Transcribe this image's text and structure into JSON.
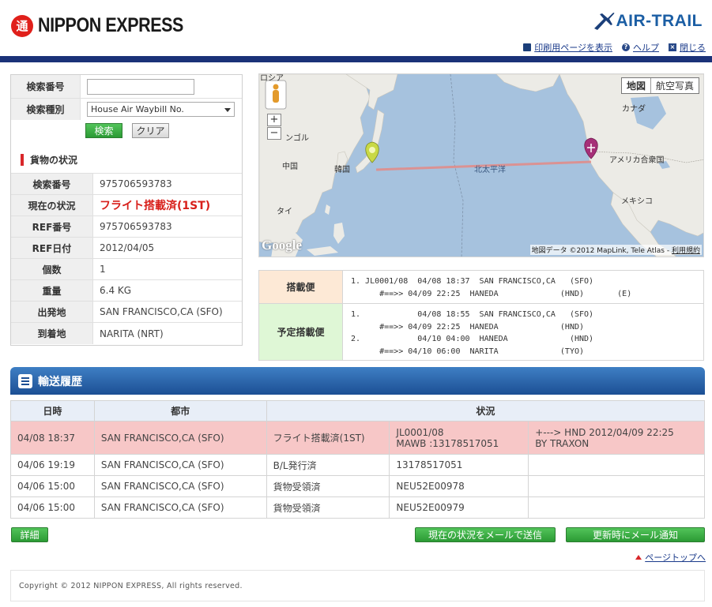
{
  "header": {
    "brand_left": "NIPPON EXPRESS",
    "brand_left_mark": "通",
    "brand_right": "AIR-TRAIL",
    "links": {
      "print": "印刷用ページを表示",
      "help": "ヘルプ",
      "close": "閉じる"
    }
  },
  "search": {
    "number_label": "検索番号",
    "number_value": "",
    "type_label": "検索種別",
    "type_selected": "House Air Waybill No.",
    "search_button": "検索",
    "clear_button": "クリア"
  },
  "status": {
    "title": "貨物の状況",
    "rows": [
      {
        "label": "検索番号",
        "value": "975706593783"
      },
      {
        "label": "現在の状況",
        "value": "フライト搭載済(1ST)"
      },
      {
        "label": "REF番号",
        "value": "975706593783"
      },
      {
        "label": "REF日付",
        "value": "2012/04/05"
      },
      {
        "label": "個数",
        "value": "1"
      },
      {
        "label": "重量",
        "value": "6.4 KG"
      },
      {
        "label": "出発地",
        "value": "SAN FRANCISCO,CA (SFO)"
      },
      {
        "label": "到着地",
        "value": "NARITA (NRT)"
      }
    ]
  },
  "map": {
    "toggle_map": "地図",
    "toggle_aerial": "航空写真",
    "zoom_in": "+",
    "zoom_out": "−",
    "labels": {
      "canada": "カナダ",
      "usa": "アメリカ合衆国",
      "mexico": "メキシコ",
      "pacific": "北太平洋",
      "china": "中国",
      "korea": "韓国",
      "mongolia": "ンゴル",
      "thailand": "タイ",
      "russia": "ロシア"
    },
    "google": "Google",
    "attribution_text": "地図データ ©2012 MapLink, Tele Atlas - ",
    "attribution_link": "利用規約"
  },
  "flights": {
    "loaded_label": "搭載便",
    "loaded_text": "1. JL0001/08  04/08 18:37  SAN FRANCISCO,CA   (SFO)\n      #==>> 04/09 22:25  HANEDA             (HND)       (E)",
    "planned_label": "予定搭載便",
    "planned_text": "1.            04/08 18:55  SAN FRANCISCO,CA   (SFO)\n      #==>> 04/09 22:25  HANEDA             (HND)\n2.            04/10 04:00  HANEDA             (HND)\n      #==>> 04/10 06:00  NARITA             (TYO)"
  },
  "history": {
    "title": "輸送履歴",
    "columns": [
      "日時",
      "都市",
      "状況"
    ],
    "rows": [
      {
        "datetime": "04/08 18:37",
        "city": "SAN FRANCISCO,CA (SFO)",
        "status": "フライト搭載済(1ST)",
        "detail1": "JL0001/08",
        "detail1b": "MAWB :13178517051",
        "detail2": "+---> HND 2012/04/09 22:25",
        "detail2b": "BY TRAXON"
      },
      {
        "datetime": "04/06 19:19",
        "city": "SAN FRANCISCO,CA (SFO)",
        "status": "B/L発行済",
        "detail1": "13178517051",
        "detail1b": "",
        "detail2": "",
        "detail2b": ""
      },
      {
        "datetime": "04/06 15:00",
        "city": "SAN FRANCISCO,CA (SFO)",
        "status": "貨物受領済",
        "detail1": "NEU52E00978",
        "detail1b": "",
        "detail2": "",
        "detail2b": ""
      },
      {
        "datetime": "04/06 15:00",
        "city": "SAN FRANCISCO,CA (SFO)",
        "status": "貨物受領済",
        "detail1": "NEU52E00979",
        "detail1b": "",
        "detail2": "",
        "detail2b": ""
      }
    ]
  },
  "actions": {
    "detail": "詳細",
    "email_now": "現在の状況をメールで送信",
    "email_update": "更新時にメール通知",
    "page_top": "ページトップへ"
  },
  "footer": {
    "copyright": "Copyright © 2012 NIPPON EXPRESS, All rights reserved."
  }
}
